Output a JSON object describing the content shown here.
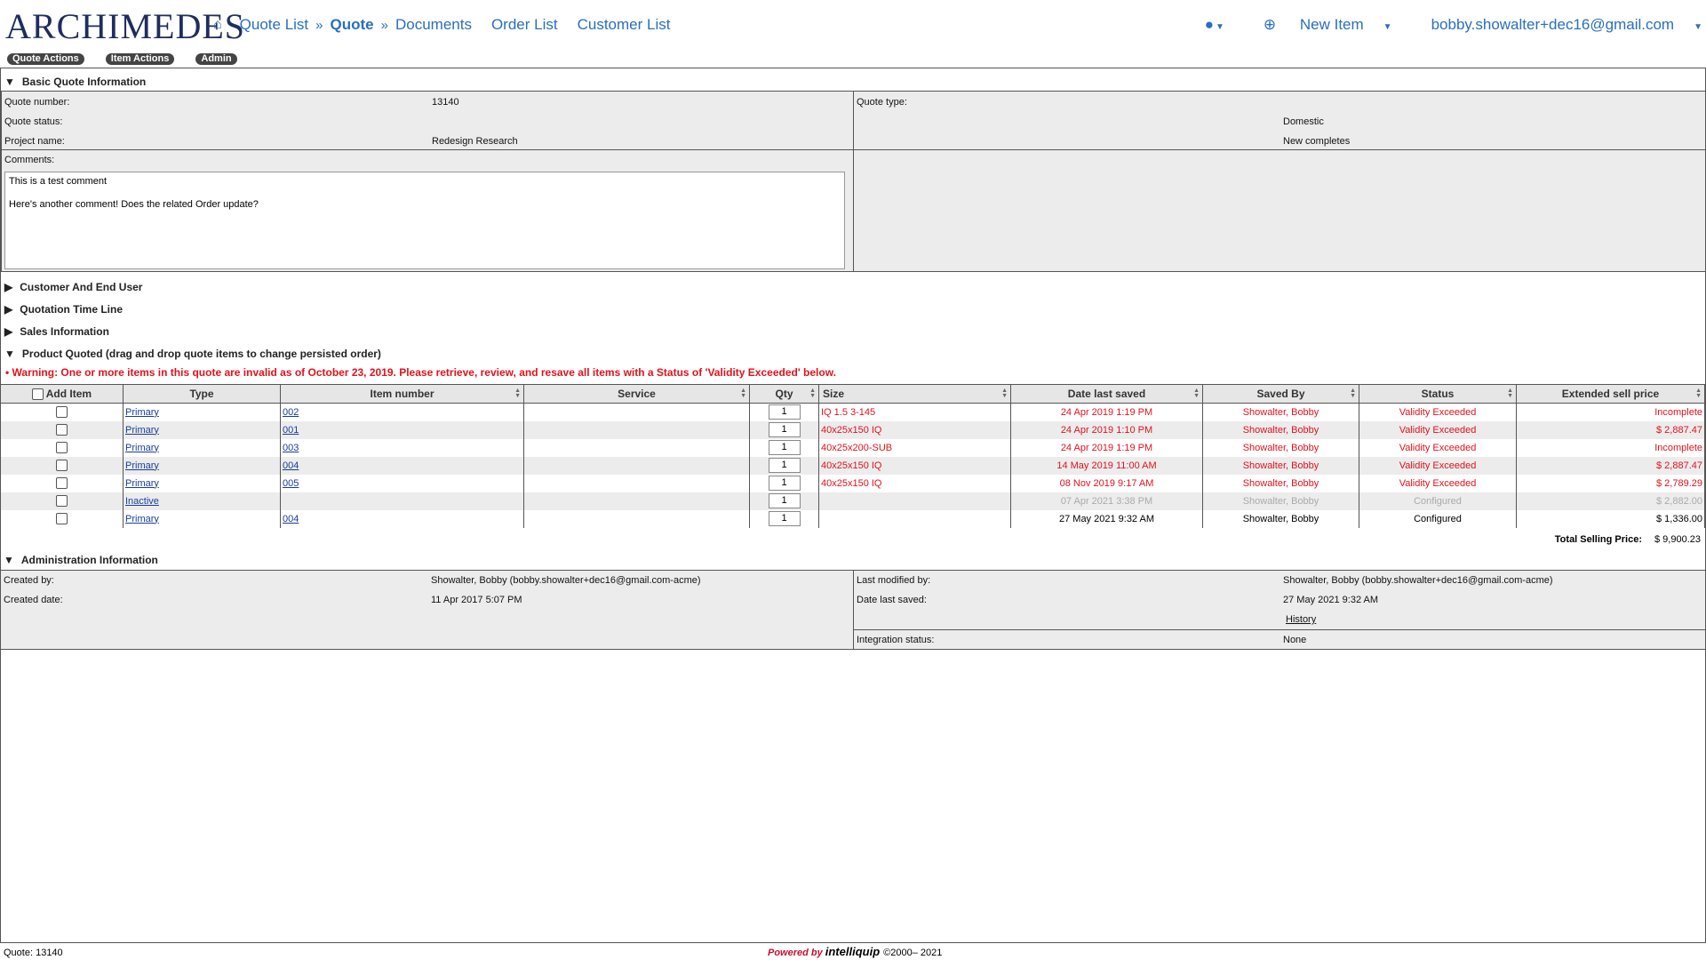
{
  "app": {
    "logo": "ARCHIMEDES"
  },
  "nav": {
    "home_icon": "home-icon",
    "breadcrumb": [
      "Quote List",
      "Quote",
      "Documents"
    ],
    "links": [
      "Order List",
      "Customer List"
    ],
    "right": {
      "globe_icon": "globe-icon",
      "new_item": "New Item",
      "user": "bobby.showalter+dec16@gmail.com"
    }
  },
  "actions": [
    "Quote Actions",
    "Item Actions",
    "Admin"
  ],
  "basic": {
    "title": "Basic Quote Information",
    "quote_number_label": "Quote number:",
    "quote_number": "13140",
    "quote_status_label": "Quote status:",
    "project_name_label": "Project name:",
    "project_name": "Redesign Research",
    "quote_type_label": "Quote type:",
    "quote_type_1": "Domestic",
    "quote_type_2": "New completes",
    "comments_label": "Comments:",
    "comments": "This is a test comment\n\nHere's another comment! Does the related Order update?"
  },
  "sections": {
    "customer": "Customer And End User",
    "timeline": "Quotation Time Line",
    "sales": "Sales Information",
    "product": "Product Quoted (drag and drop quote items to change persisted order)",
    "admin": "Administration Information"
  },
  "warning": "Warning: One or more items in this quote are invalid as of October 23, 2019. Please retrieve, review, and resave all items with a Status of 'Validity Exceeded' below.",
  "table": {
    "headers": [
      "Add Item",
      "Type",
      "Item number",
      "Service",
      "Qty",
      "Size",
      "Date last saved",
      "Saved By",
      "Status",
      "Extended sell price"
    ],
    "rows": [
      {
        "type": "Primary",
        "item": "002",
        "service": "",
        "qty": "1",
        "size": "IQ 1.5 3-145",
        "date": "24 Apr 2019 1:19 PM",
        "saved_by": "Showalter, Bobby",
        "status": "Validity Exceeded",
        "price": "Incomplete",
        "style": "red"
      },
      {
        "type": "Primary",
        "item": "001",
        "service": "",
        "qty": "1",
        "size": "40x25x150 IQ",
        "date": "24 Apr 2019 1:10 PM",
        "saved_by": "Showalter, Bobby",
        "status": "Validity Exceeded",
        "price": "$ 2,887.47",
        "style": "red"
      },
      {
        "type": "Primary",
        "item": "003",
        "service": "",
        "qty": "1",
        "size": "40x25x200-SUB",
        "date": "24 Apr 2019 1:19 PM",
        "saved_by": "Showalter, Bobby",
        "status": "Validity Exceeded",
        "price": "Incomplete",
        "style": "red"
      },
      {
        "type": "Primary",
        "item": "004",
        "service": "",
        "qty": "1",
        "size": "40x25x150 IQ",
        "date": "14 May 2019 11:00 AM",
        "saved_by": "Showalter, Bobby",
        "status": "Validity Exceeded",
        "price": "$ 2,887.47",
        "style": "red"
      },
      {
        "type": "Primary",
        "item": "005",
        "service": "",
        "qty": "1",
        "size": "40x25x150 IQ",
        "date": "08 Nov 2019 9:17 AM",
        "saved_by": "Showalter, Bobby",
        "status": "Validity Exceeded",
        "price": "$ 2,789.29",
        "style": "red"
      },
      {
        "type": "Inactive",
        "item": "",
        "service": "",
        "qty": "1",
        "size": "",
        "date": "07 Apr 2021 3:38 PM",
        "saved_by": "Showalter, Bobby",
        "status": "Configured",
        "price": "$ 2,882.00",
        "style": "grey"
      },
      {
        "type": "Primary",
        "item": "004",
        "service": "",
        "qty": "1",
        "size": "",
        "date": "27 May 2021 9:32 AM",
        "saved_by": "Showalter, Bobby",
        "status": "Configured",
        "price": "$ 1,336.00",
        "style": "normal"
      }
    ],
    "total_label": "Total Selling Price:",
    "total_value": "$ 9,900.23"
  },
  "admin": {
    "created_by_label": "Created by:",
    "created_by": "Showalter, Bobby (bobby.showalter+dec16@gmail.com-acme)",
    "created_date_label": "Created date:",
    "created_date": "11 Apr 2017 5:07 PM",
    "modified_by_label": "Last modified by:",
    "modified_by": "Showalter, Bobby (bobby.showalter+dec16@gmail.com-acme)",
    "date_saved_label": "Date last saved:",
    "date_saved": "27 May 2021 9:32 AM",
    "history": "History",
    "integration_label": "Integration status:",
    "integration": "None"
  },
  "footer": {
    "quote": "Quote: 13140",
    "powered": "Powered by",
    "brand": "intelliquip",
    "copyright": "©2000– 2021"
  },
  "colors": {
    "link": "#2a6fbf",
    "warning": "#e3121b",
    "panel": "#ececec"
  }
}
